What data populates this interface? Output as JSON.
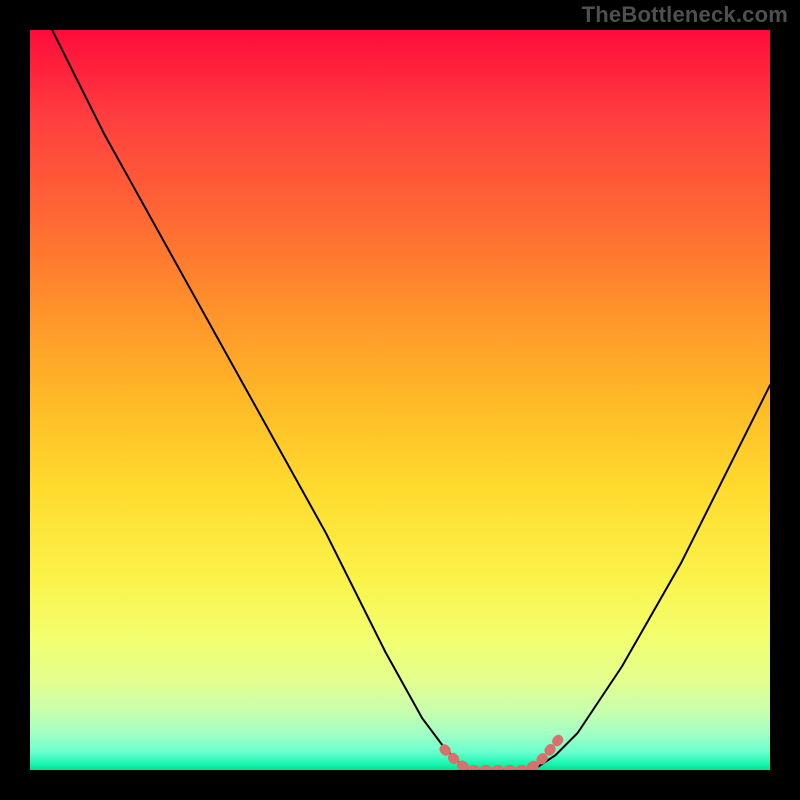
{
  "watermark": "TheBottleneck.com",
  "chart_data": {
    "type": "line",
    "title": "",
    "xlabel": "",
    "ylabel": "",
    "xlim": [
      0,
      1
    ],
    "ylim": [
      0,
      1
    ],
    "series": [
      {
        "name": "black-curve",
        "x": [
          0.03,
          0.1,
          0.2,
          0.3,
          0.4,
          0.48,
          0.53,
          0.56,
          0.59,
          0.68,
          0.71,
          0.74,
          0.8,
          0.88,
          0.95,
          1.0
        ],
        "y": [
          1.0,
          0.86,
          0.68,
          0.5,
          0.32,
          0.16,
          0.07,
          0.03,
          0.0,
          0.0,
          0.02,
          0.05,
          0.14,
          0.28,
          0.42,
          0.52
        ]
      },
      {
        "name": "red-plateau",
        "x": [
          0.56,
          0.57,
          0.58,
          0.595,
          0.62,
          0.645,
          0.67,
          0.685,
          0.695,
          0.705,
          0.715
        ],
        "y": [
          0.028,
          0.018,
          0.008,
          0.0,
          0.0,
          0.0,
          0.0,
          0.008,
          0.018,
          0.03,
          0.042
        ]
      }
    ],
    "colors": {
      "gradient_top": "#ff0b3a",
      "gradient_mid": "#ffdb2e",
      "gradient_bottom": "#00e48f",
      "curve": "#000000",
      "plateau": "#d9706d"
    }
  }
}
